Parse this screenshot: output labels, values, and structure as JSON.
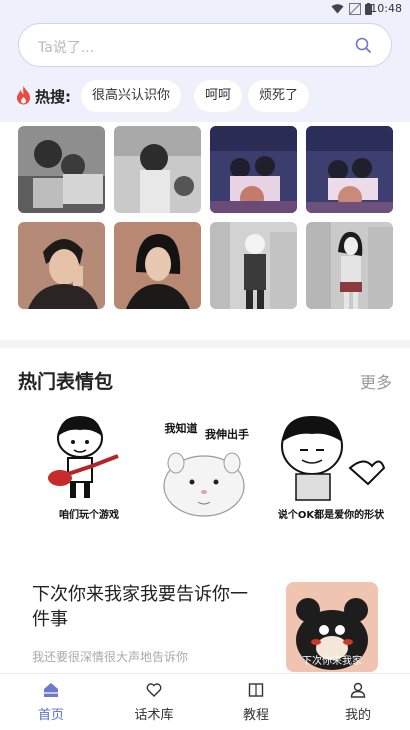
{
  "status_bar": {
    "time": "10:48"
  },
  "search": {
    "placeholder": "Ta说了..."
  },
  "hot_search": {
    "label": "热搜:",
    "tags": [
      "很高兴认识你",
      "呵呵",
      "烦死了"
    ]
  },
  "memes": {
    "title": "热门表情包",
    "more_label": "更多",
    "items": [
      {
        "caption": "咱们玩个游戏"
      },
      {
        "text_line1": "我知道",
        "text_line2": "我伸出手"
      },
      {
        "caption": "说个OK都是爱你的形状"
      }
    ]
  },
  "article": {
    "title": "下次你来我家我要告诉你一件事",
    "desc": "我还要很深情很大声地告诉你",
    "thumb_caption": "下次你来我家"
  },
  "tabs": [
    {
      "label": "首页",
      "icon": "home-icon",
      "active": true
    },
    {
      "label": "话术库",
      "icon": "heart-chat-icon",
      "active": false
    },
    {
      "label": "教程",
      "icon": "book-icon",
      "active": false
    },
    {
      "label": "我的",
      "icon": "user-icon",
      "active": false
    }
  ],
  "colors": {
    "accent": "#5a6fd0",
    "header_bg": "#eef0fb",
    "fire": "#f0483e"
  }
}
